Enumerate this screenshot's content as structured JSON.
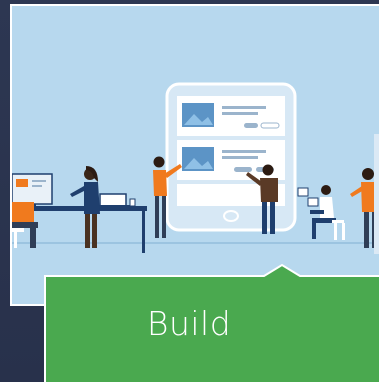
{
  "card": {
    "label": "Build"
  },
  "colors": {
    "background": "#2b3550",
    "illustration_sky": "#b7d8ee",
    "tab_green": "#4aa94f",
    "tab_border": "#ffffff",
    "accent_orange": "#f07a1e"
  },
  "icons": {
    "scene": "team-building-app-illustration",
    "device": "tablet-icon"
  }
}
